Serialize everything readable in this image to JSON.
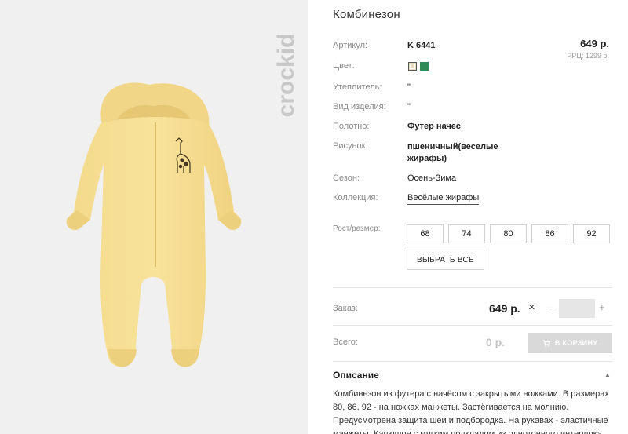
{
  "product": {
    "title": "Комбинезон",
    "brand": "crockid",
    "price": "649 р.",
    "rrp": "РРЦ: 1299 р."
  },
  "specs": [
    {
      "label": "Артикул:",
      "value": "K 6441"
    },
    {
      "label": "Цвет:",
      "value": ""
    },
    {
      "label": "Утеплитель:",
      "value": "\""
    },
    {
      "label": "Вид изделия:",
      "value": "\""
    },
    {
      "label": "Полотно:",
      "value": "Футер начес"
    },
    {
      "label": "Рисунок:",
      "value": "пшеничный(веселые жирафы)"
    },
    {
      "label": "Сезон:",
      "value": "Осень-Зима"
    },
    {
      "label": "Коллекция:",
      "value": "Весёлые жирафы"
    }
  ],
  "colors": [
    "#e9dcc0",
    "#2e8b57"
  ],
  "sizes": {
    "label": "Рост/размер:",
    "options": [
      "68",
      "74",
      "80",
      "86",
      "92"
    ],
    "select_all": "ВЫБРАТЬ ВСЕ"
  },
  "order": {
    "label": "Заказ:",
    "price": "649 р.",
    "clear": "×",
    "minus": "−",
    "plus": "+",
    "quantity": ""
  },
  "total": {
    "label": "Всего:",
    "value": "0 р.",
    "cart_button": "В КОРЗИНУ"
  },
  "description": {
    "title": "Описание",
    "toggle_icon": "chevron-up-icon",
    "text": "Комбинезон из футера с начёсом с закрытыми ножками. В размерах 80, 86, 92 - на ножках манжеты. Застёгивается на молнию. Предусмотрена защита шеи и подбородка. На рукавах - эластичные манжеты. Капюшон с мягким подкладом из однотонного интерлока."
  }
}
